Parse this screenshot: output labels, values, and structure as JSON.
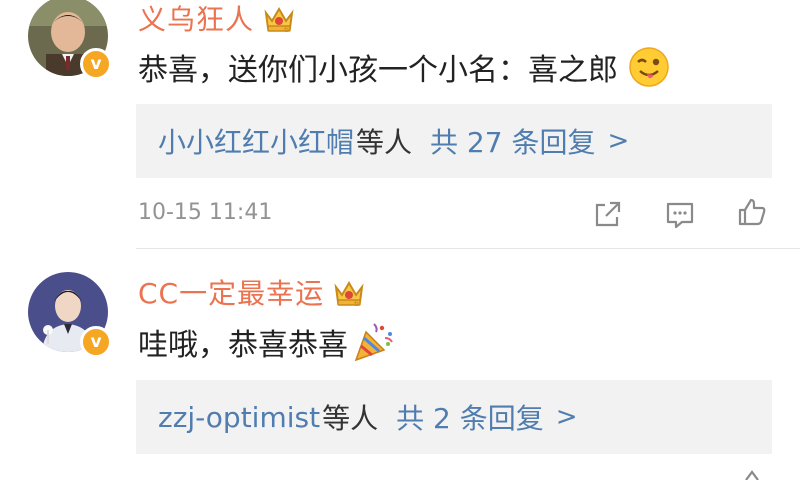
{
  "comments": [
    {
      "username": "义乌狂人",
      "text": "恭喜，送你们小孩一个小名：喜之郎",
      "emoji": "winking-tongue-emoji",
      "replies": {
        "users": "小小红红小红帽",
        "suffix": "等人",
        "total": "共 27 条回复",
        "arrow": ">"
      },
      "timestamp": "10-15 11:41"
    },
    {
      "username": "CC一定最幸运",
      "text": "哇哦，恭喜恭喜",
      "emoji": "party-popper-emoji",
      "replies": {
        "users": "zzj-optimist",
        "suffix": "等人",
        "total": "共 2 条回复",
        "arrow": ">"
      }
    }
  ],
  "colors": {
    "username": "#eb7350",
    "link": "#507daf",
    "verified_badge": "#f5a623",
    "reply_box_bg": "#f2f2f2",
    "timestamp": "#939393"
  }
}
